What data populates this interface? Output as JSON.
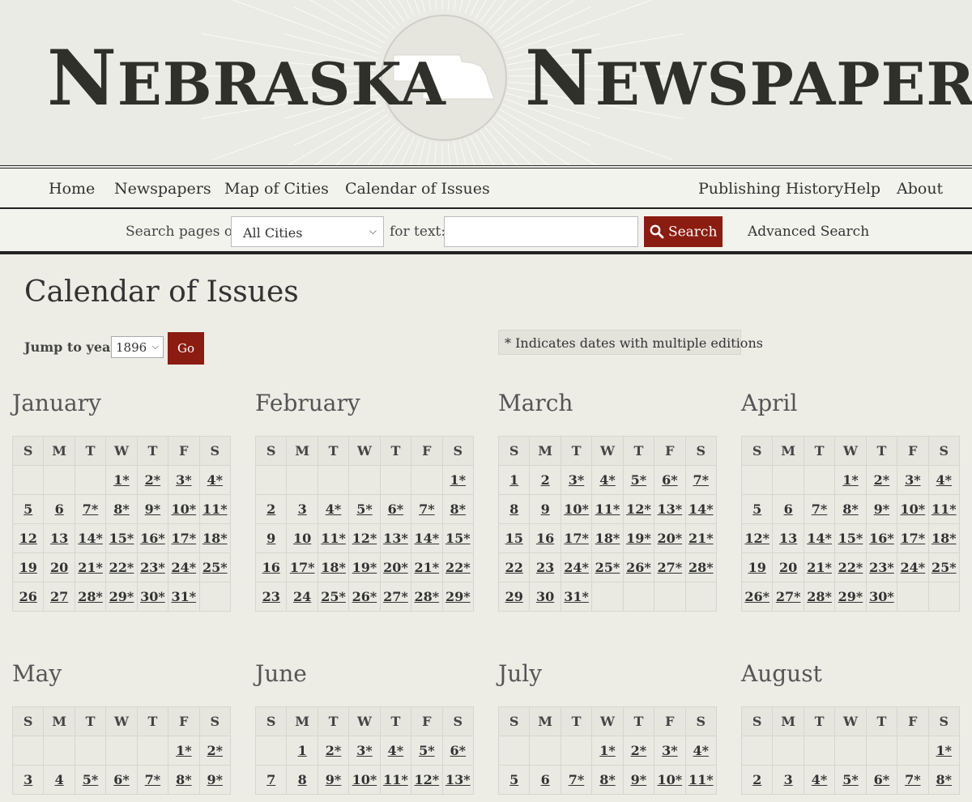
{
  "site": {
    "title_left_initial": "N",
    "title_left_rest": "EBRASKA",
    "title_right_initial": "N",
    "title_right_rest": "EWSPAPERS"
  },
  "nav": {
    "left": [
      "Home",
      "Newspapers",
      "Map of Cities",
      "Calendar of Issues"
    ],
    "right": [
      "Publishing History",
      "Help",
      "About"
    ]
  },
  "search": {
    "label": "Search pages of",
    "select_value": "All Cities",
    "text_label": "for text:",
    "input_value": "",
    "button_label": "Search",
    "advanced_label": "Advanced Search"
  },
  "page": {
    "title": "Calendar of Issues",
    "jump_label": "Jump to year",
    "year_value": "1896",
    "go_label": "Go",
    "note": "* Indicates dates with multiple editions"
  },
  "weekdays": [
    "S",
    "M",
    "T",
    "W",
    "T",
    "F",
    "S"
  ],
  "months": [
    {
      "name": "January",
      "rows": [
        [
          "",
          "",
          "",
          "1*",
          "2*",
          "3*",
          "4*"
        ],
        [
          "5",
          "6",
          "7*",
          "8*",
          "9*",
          "10*",
          "11*"
        ],
        [
          "12",
          "13",
          "14*",
          "15*",
          "16*",
          "17*",
          "18*"
        ],
        [
          "19",
          "20",
          "21*",
          "22*",
          "23*",
          "24*",
          "25*"
        ],
        [
          "26",
          "27",
          "28*",
          "29*",
          "30*",
          "31*",
          ""
        ]
      ]
    },
    {
      "name": "February",
      "rows": [
        [
          "",
          "",
          "",
          "",
          "",
          "",
          "1*"
        ],
        [
          "2",
          "3",
          "4*",
          "5*",
          "6*",
          "7*",
          "8*"
        ],
        [
          "9",
          "10",
          "11*",
          "12*",
          "13*",
          "14*",
          "15*"
        ],
        [
          "16",
          "17*",
          "18*",
          "19*",
          "20*",
          "21*",
          "22*"
        ],
        [
          "23",
          "24",
          "25*",
          "26*",
          "27*",
          "28*",
          "29*"
        ]
      ]
    },
    {
      "name": "March",
      "rows": [
        [
          "1",
          "2",
          "3*",
          "4*",
          "5*",
          "6*",
          "7*"
        ],
        [
          "8",
          "9",
          "10*",
          "11*",
          "12*",
          "13*",
          "14*"
        ],
        [
          "15",
          "16",
          "17*",
          "18*",
          "19*",
          "20*",
          "21*"
        ],
        [
          "22",
          "23",
          "24*",
          "25*",
          "26*",
          "27*",
          "28*"
        ],
        [
          "29",
          "30",
          "31*",
          "",
          "",
          "",
          ""
        ]
      ]
    },
    {
      "name": "April",
      "rows": [
        [
          "",
          "",
          "",
          "1*",
          "2*",
          "3*",
          "4*"
        ],
        [
          "5",
          "6",
          "7*",
          "8*",
          "9*",
          "10*",
          "11*"
        ],
        [
          "12*",
          "13",
          "14*",
          "15*",
          "16*",
          "17*",
          "18*"
        ],
        [
          "19",
          "20",
          "21*",
          "22*",
          "23*",
          "24*",
          "25*"
        ],
        [
          "26*",
          "27*",
          "28*",
          "29*",
          "30*",
          "",
          ""
        ]
      ]
    },
    {
      "name": "May",
      "rows": [
        [
          "",
          "",
          "",
          "",
          "",
          "1*",
          "2*"
        ],
        [
          "3",
          "4",
          "5*",
          "6*",
          "7*",
          "8*",
          "9*"
        ]
      ]
    },
    {
      "name": "June",
      "rows": [
        [
          "",
          "1",
          "2*",
          "3*",
          "4*",
          "5*",
          "6*"
        ],
        [
          "7",
          "8",
          "9*",
          "10*",
          "11*",
          "12*",
          "13*"
        ]
      ]
    },
    {
      "name": "July",
      "rows": [
        [
          "",
          "",
          "",
          "1*",
          "2*",
          "3*",
          "4*"
        ],
        [
          "5",
          "6",
          "7*",
          "8*",
          "9*",
          "10*",
          "11*"
        ]
      ]
    },
    {
      "name": "August",
      "rows": [
        [
          "",
          "",
          "",
          "",
          "",
          "",
          "1*"
        ],
        [
          "2",
          "3",
          "4*",
          "5*",
          "6*",
          "7*",
          "8*"
        ]
      ]
    }
  ]
}
